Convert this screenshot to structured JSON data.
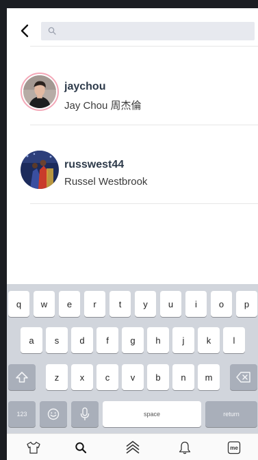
{
  "search": {
    "value": "",
    "placeholder": ""
  },
  "results": [
    {
      "username": "jaychou",
      "full_name": "Jay Chou 周杰倫",
      "avatar_ring_color": "#f3a7b7"
    },
    {
      "username": "russwest44",
      "full_name": "Russel Westbrook"
    }
  ],
  "keyboard": {
    "row1": [
      "q",
      "w",
      "e",
      "r",
      "t",
      "y",
      "u",
      "i",
      "o",
      "p"
    ],
    "row2": [
      "a",
      "s",
      "d",
      "f",
      "g",
      "h",
      "j",
      "k",
      "l"
    ],
    "row3": [
      "z",
      "x",
      "c",
      "v",
      "b",
      "n",
      "m"
    ],
    "numbers_label": "123",
    "space_label": "space",
    "return_label": "return"
  },
  "tab_bar": {
    "items": [
      {
        "icon": "shirt-icon"
      },
      {
        "icon": "search-icon"
      },
      {
        "icon": "chevrons-up-icon"
      },
      {
        "icon": "bell-icon"
      },
      {
        "icon": "me-icon",
        "label": "me"
      }
    ]
  },
  "colors": {
    "accent_ring": "#f3a7b7",
    "search_bg": "#e7e9ef",
    "keyboard_bg": "#d1d5dc",
    "dark_key": "#a9afba"
  }
}
